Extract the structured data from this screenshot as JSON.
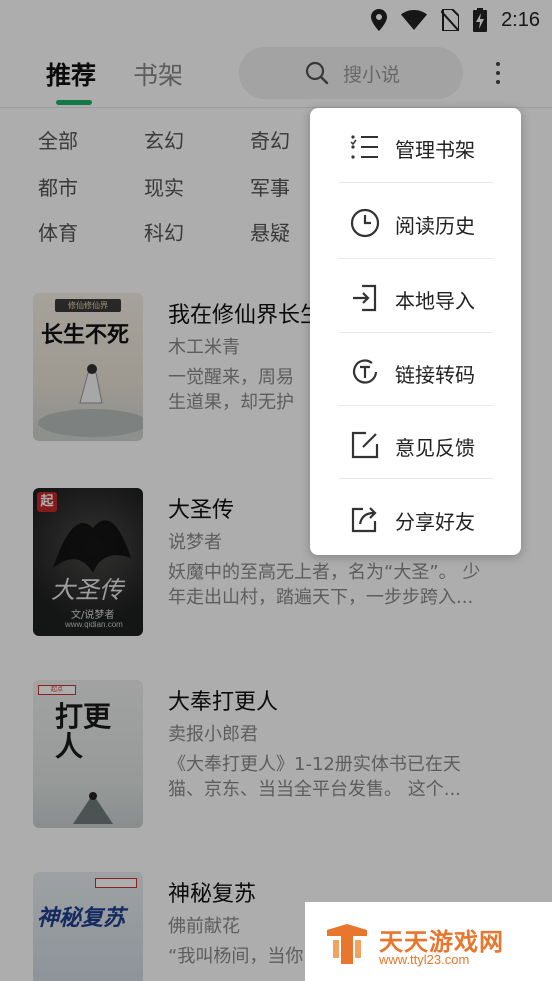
{
  "status_bar": {
    "time": "2:16"
  },
  "header": {
    "tab_recommend": "推荐",
    "tab_bookshelf": "书架",
    "search_placeholder": "搜小说"
  },
  "categories": [
    [
      "全部",
      "玄幻",
      "奇幻"
    ],
    [
      "都市",
      "现实",
      "军事"
    ],
    [
      "体育",
      "科幻",
      "悬疑"
    ]
  ],
  "books": [
    {
      "title": "我在修仙界长生",
      "author": "木工米青",
      "desc_line1": "一觉醒来，周易",
      "desc_line2": "生道果，却无护",
      "cover_text": "长生不死",
      "cover_badge": "修仙修仙界"
    },
    {
      "title": "大圣传",
      "author": "说梦者",
      "desc_line1": "妖魔中的至高无上者，名为“大圣”。 少",
      "desc_line2": "年走出山村，踏遍天下，一步步跨入...",
      "cover_text": "大圣传",
      "cover_sub": "文/说梦者",
      "cover_site": "www.qidian.com"
    },
    {
      "title": "大奉打更人",
      "author": "卖报小郎君",
      "desc_line1": "《大奉打更人》1-12册实体书已在天",
      "desc_line2": "猫、京东、当当全平台发售。 这个...",
      "cover_text": "打更人"
    },
    {
      "title": "神秘复苏",
      "author": "佛前献花",
      "desc_line1": "“我叫杨间，当你",
      "desc_line2": "",
      "cover_text": "神秘复苏"
    }
  ],
  "menu": [
    {
      "icon": "list-icon",
      "label": "管理书架"
    },
    {
      "icon": "clock-icon",
      "label": "阅读历史"
    },
    {
      "icon": "import-icon",
      "label": "本地导入"
    },
    {
      "icon": "transcode-icon",
      "label": "链接转码"
    },
    {
      "icon": "edit-icon",
      "label": "意见反馈"
    },
    {
      "icon": "share-icon",
      "label": "分享好友"
    }
  ],
  "watermark": {
    "title": "天天游戏网",
    "url": "www.ttyl23.com"
  },
  "colors": {
    "accent": "#1db36b",
    "watermark": "#e8762c"
  }
}
